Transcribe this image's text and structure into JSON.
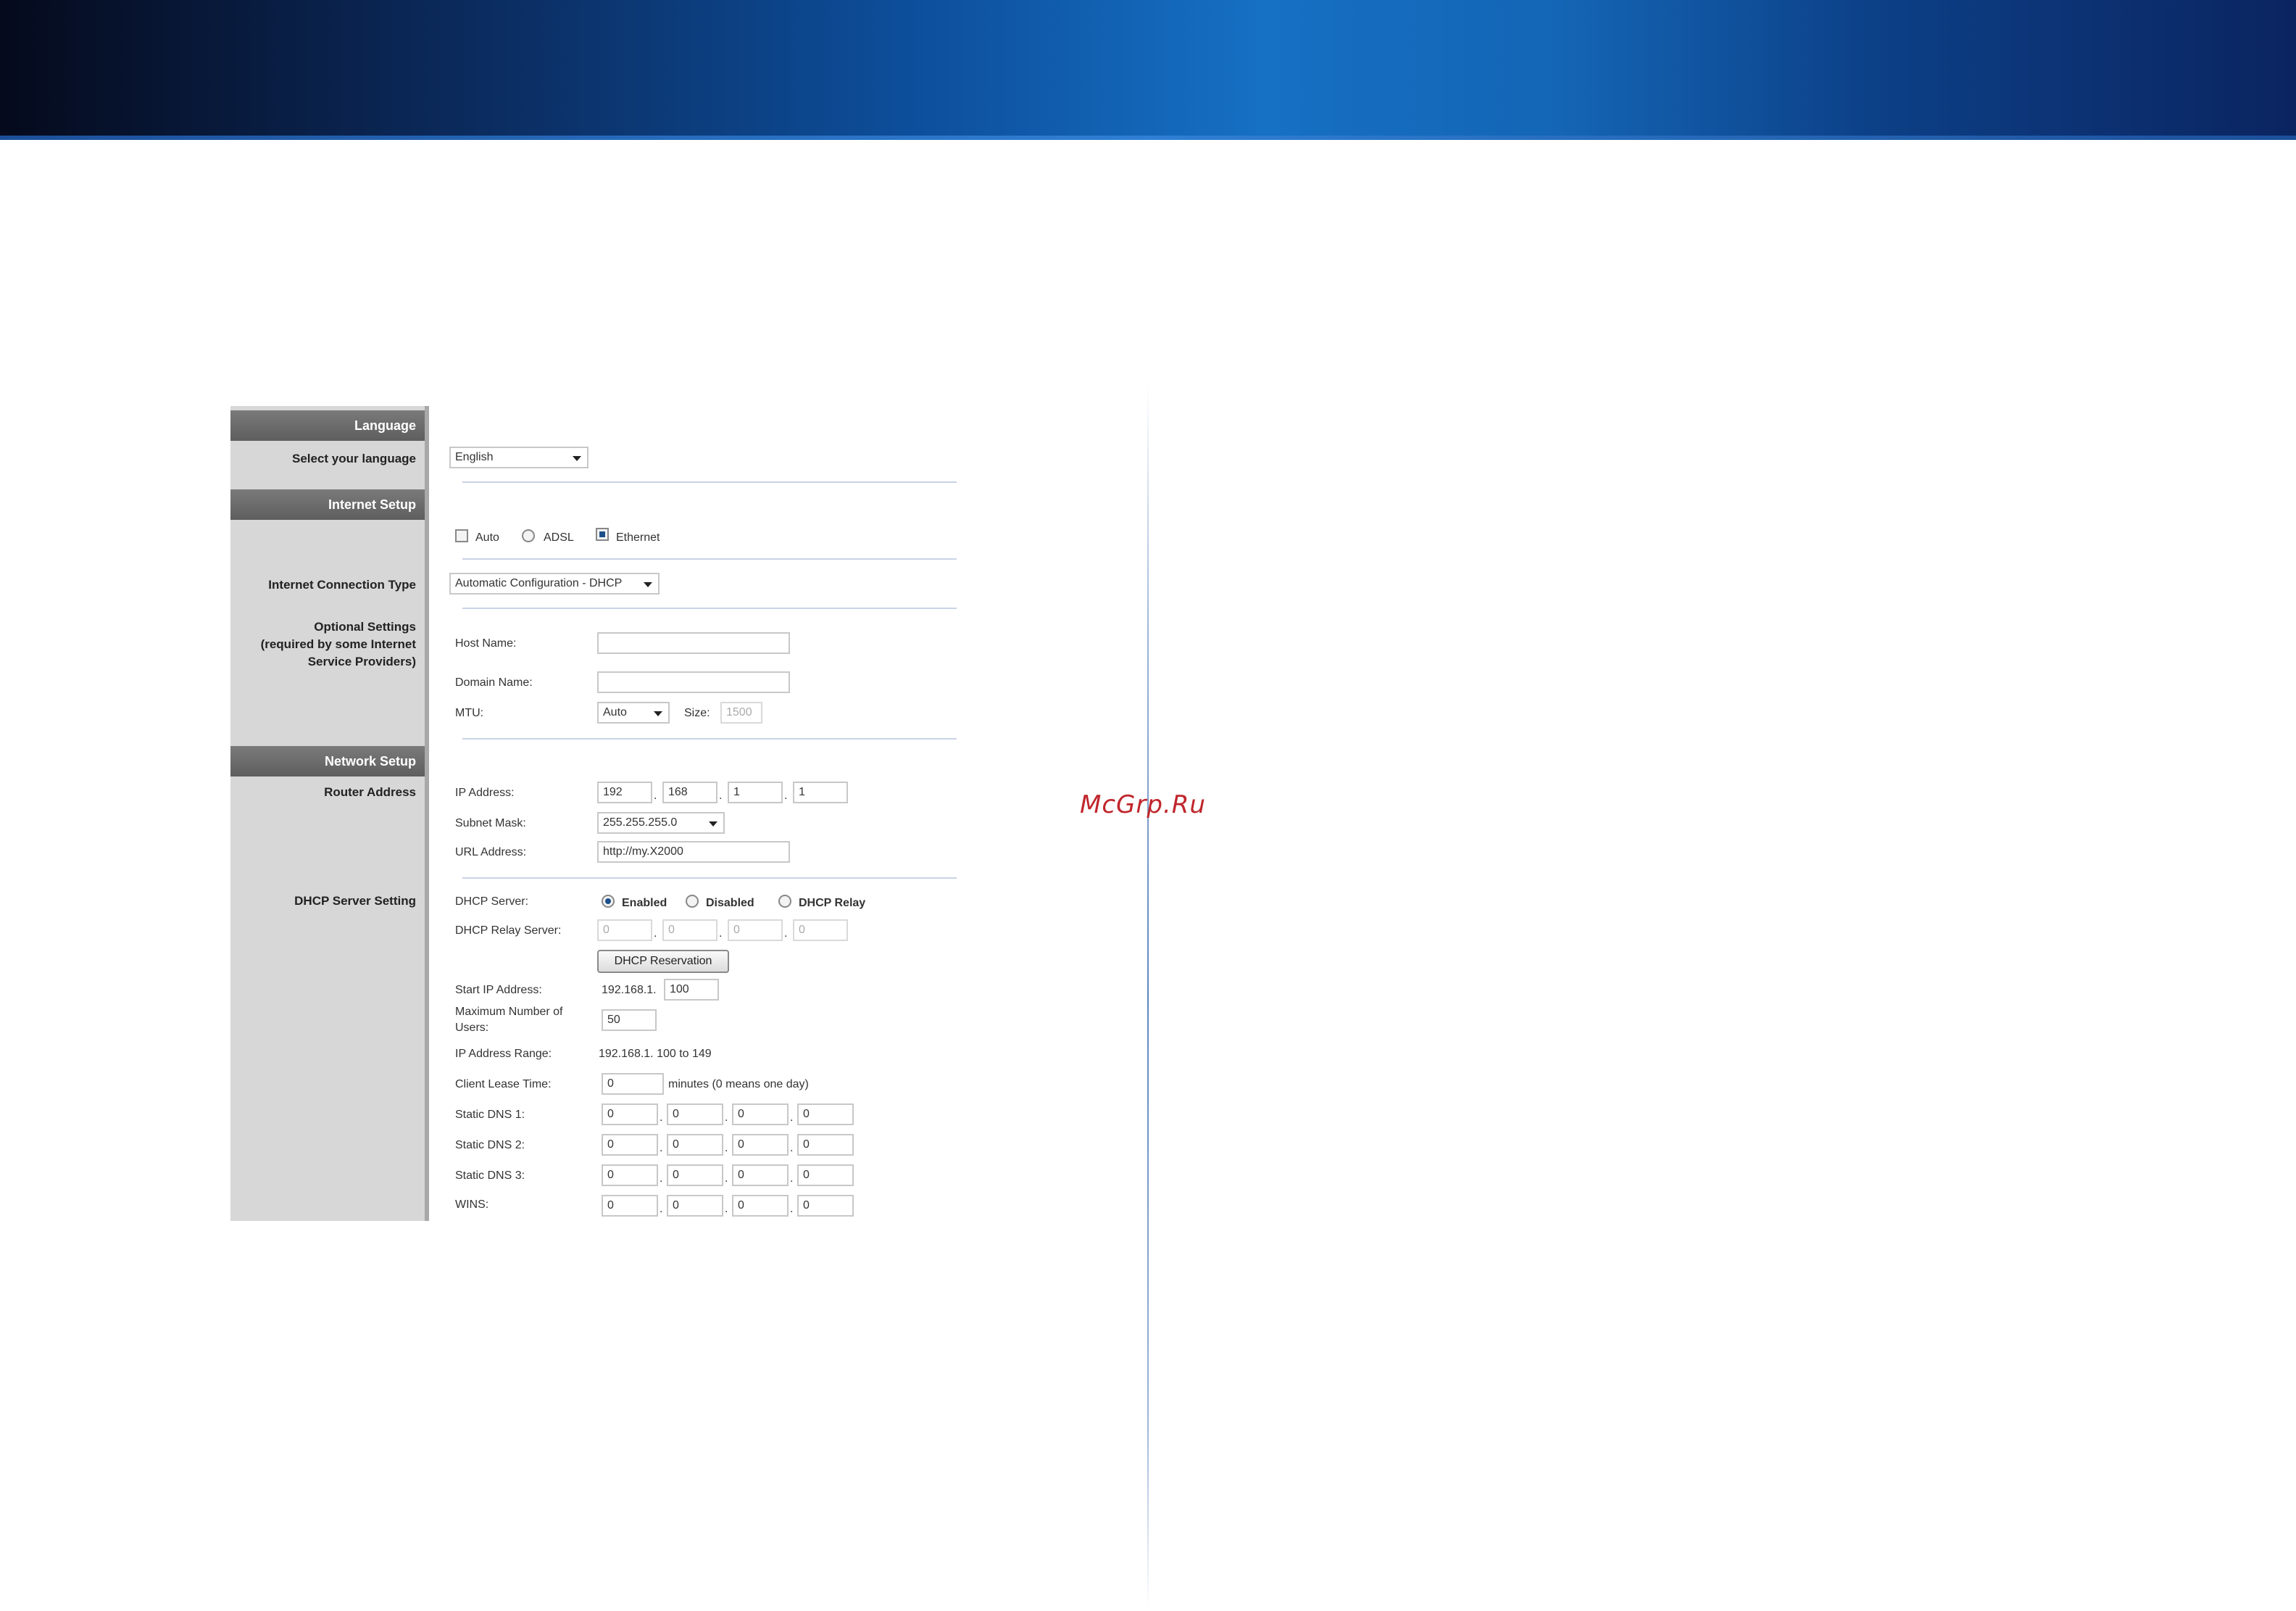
{
  "watermark": "McGrp.Ru",
  "language": {
    "header": "Language",
    "select_label": "Select your language",
    "selected": "English"
  },
  "internet_setup": {
    "header": "Internet Setup",
    "mode_options": [
      "Auto",
      "ADSL",
      "Ethernet"
    ],
    "mode_selected": "Ethernet",
    "connection_type_label": "Internet Connection Type",
    "connection_type_value": "Automatic Configuration - DHCP",
    "optional_label_1": "Optional Settings",
    "optional_label_2": "(required by some Internet",
    "optional_label_3": "Service Providers)",
    "host_name_label": "Host Name:",
    "host_name_value": "",
    "domain_name_label": "Domain Name:",
    "domain_name_value": "",
    "mtu_label": "MTU:",
    "mtu_value": "Auto",
    "size_label": "Size:",
    "size_value": "1500"
  },
  "network_setup": {
    "header": "Network Setup",
    "router_address_label": "Router Address",
    "ip_address_label": "IP Address:",
    "ip_octets": [
      "192",
      "168",
      "1",
      "1"
    ],
    "subnet_mask_label": "Subnet Mask:",
    "subnet_mask_value": "255.255.255.0",
    "url_address_label": "URL Address:",
    "url_address_value": "http://my.X2000",
    "dhcp_server_setting_label": "DHCP Server Setting",
    "dhcp_server_label": "DHCP Server:",
    "dhcp_options": [
      "Enabled",
      "Disabled",
      "DHCP Relay"
    ],
    "dhcp_selected": "Enabled",
    "dhcp_relay_server_label": "DHCP Relay Server:",
    "dhcp_relay_octets": [
      "0",
      "0",
      "0",
      "0"
    ],
    "dhcp_reservation_button": "DHCP Reservation",
    "start_ip_label": "Start IP Address:",
    "start_ip_prefix": "192.168.1.",
    "start_ip_value": "100",
    "max_users_label_1": "Maximum Number of",
    "max_users_label_2": "Users:",
    "max_users_value": "50",
    "ip_range_label": "IP Address Range:",
    "ip_range_value": "192.168.1. 100 to 149",
    "lease_time_label": "Client Lease Time:",
    "lease_time_value": "0",
    "lease_time_suffix": "minutes (0 means one day)",
    "dns1_label": "Static DNS 1:",
    "dns1": [
      "0",
      "0",
      "0",
      "0"
    ],
    "dns2_label": "Static DNS 2:",
    "dns2": [
      "0",
      "0",
      "0",
      "0"
    ],
    "dns3_label": "Static DNS 3:",
    "dns3": [
      "0",
      "0",
      "0",
      "0"
    ],
    "wins_label": "WINS:",
    "wins": [
      "0",
      "0",
      "0",
      "0"
    ]
  }
}
